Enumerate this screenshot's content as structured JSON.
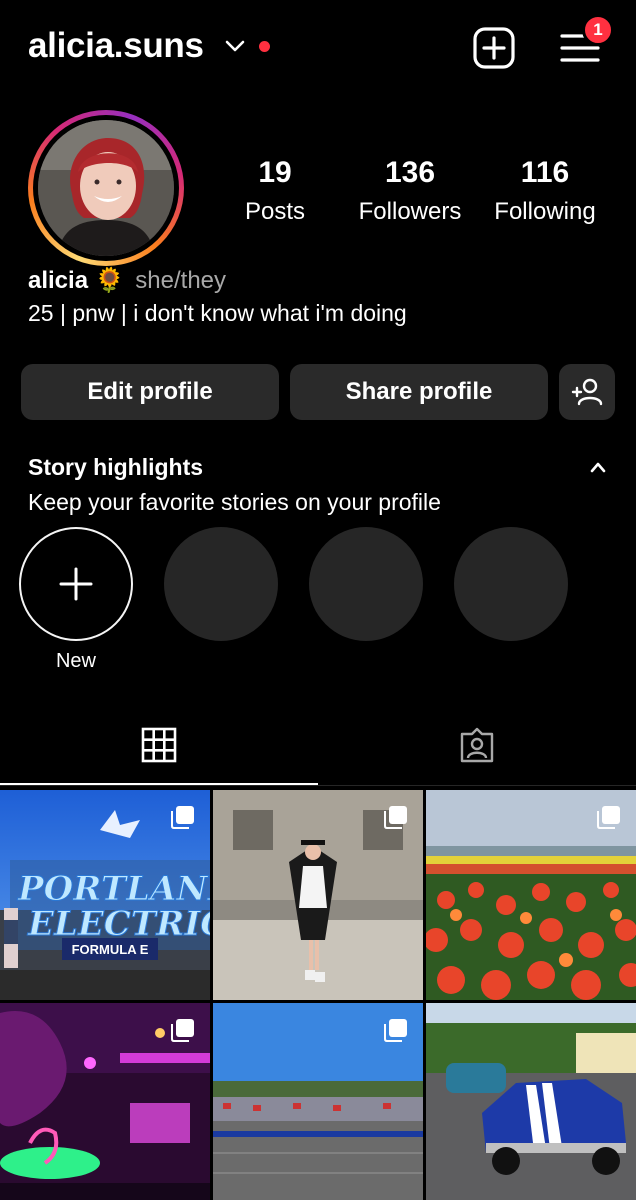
{
  "header": {
    "username": "alicia.suns",
    "notification_count": "1",
    "icons": [
      "chevron-down-icon",
      "plus-square-icon",
      "hamburger-menu-icon"
    ],
    "accent_color": "#ff3040"
  },
  "profile": {
    "stats": {
      "posts_count": "19",
      "posts_label": "Posts",
      "followers_count": "136",
      "followers_label": "Followers",
      "following_count": "116",
      "following_label": "Following"
    },
    "name": "alicia",
    "name_emoji": "🌻",
    "pronouns": "she/they",
    "bio": "25 | pnw | i don't know what i'm doing"
  },
  "actions": {
    "edit_label": "Edit profile",
    "share_label": "Share profile"
  },
  "highlights": {
    "title": "Story highlights",
    "subtitle": "Keep your favorite stories on your profile",
    "new_label": "New"
  },
  "tabs": [
    {
      "icon": "grid-icon",
      "active": true
    },
    {
      "icon": "tagged-person-icon",
      "active": false
    }
  ],
  "posts": [
    {
      "subject": "Portland Electric Formula E sign",
      "multi": true
    },
    {
      "subject": "graduation portrait",
      "multi": true
    },
    {
      "subject": "tulip field",
      "multi": true
    },
    {
      "subject": "neon lit bar",
      "multi": true
    },
    {
      "subject": "race track grandstand",
      "multi": true
    },
    {
      "subject": "classic blue mustang",
      "multi": false
    }
  ],
  "post_text": {
    "sign_line1": "PORTLAND",
    "sign_line2": "ELECTRIC",
    "sign_line3": "FORMULA E"
  }
}
